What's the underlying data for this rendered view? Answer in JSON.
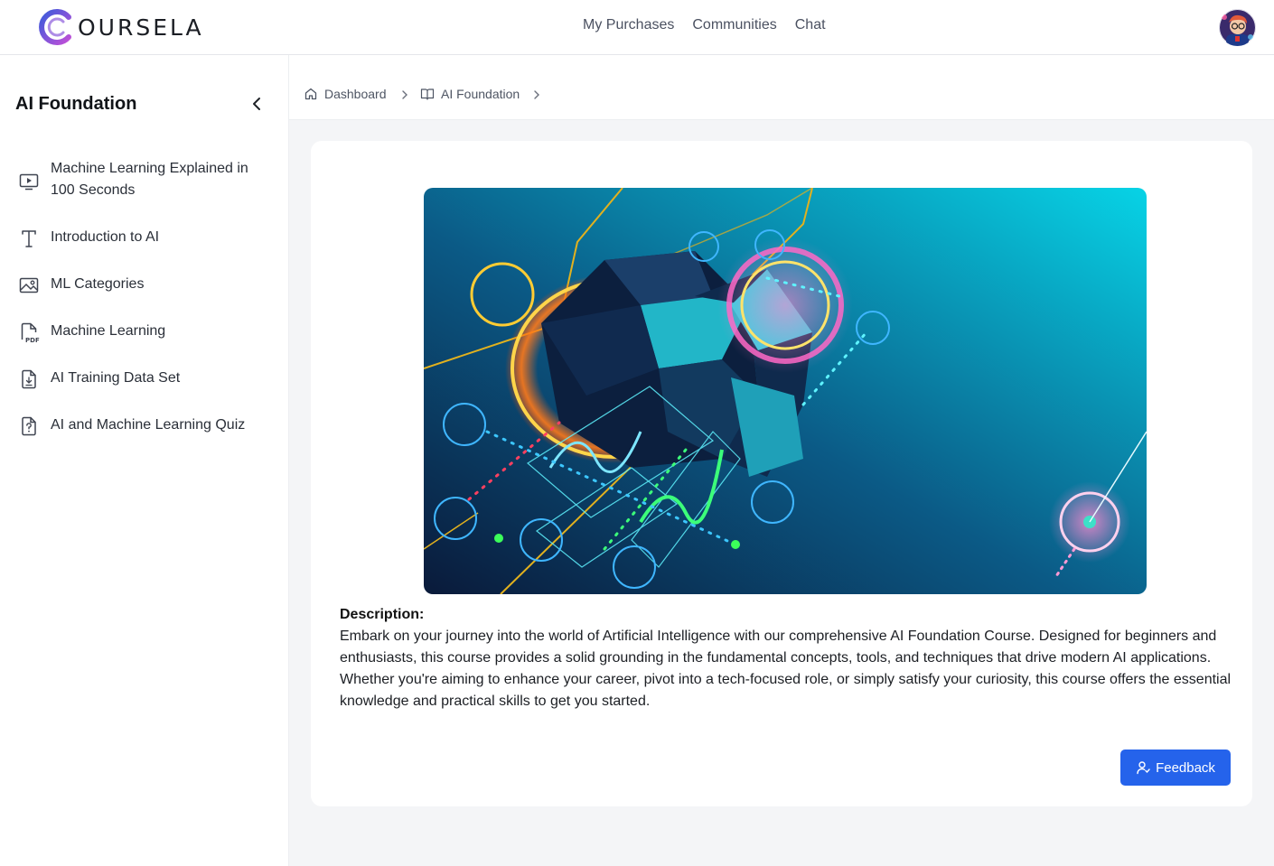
{
  "brand": {
    "name": "OURSELA"
  },
  "nav": {
    "items": [
      "My Purchases",
      "Communities",
      "Chat"
    ]
  },
  "sidebar": {
    "title": "AI Foundation",
    "lessons": [
      {
        "label": "Machine Learning Explained in 100 Seconds",
        "icon": "video-play-icon"
      },
      {
        "label": "Introduction to AI",
        "icon": "text-icon"
      },
      {
        "label": "ML Categories",
        "icon": "image-icon"
      },
      {
        "label": "Machine Learning",
        "icon": "pdf-icon"
      },
      {
        "label": "AI Training Data Set",
        "icon": "file-download-icon"
      },
      {
        "label": "AI and Machine Learning Quiz",
        "icon": "quiz-icon"
      }
    ]
  },
  "breadcrumb": {
    "items": [
      "Dashboard",
      "AI Foundation"
    ]
  },
  "course": {
    "description_heading": "Description:",
    "description": "Embark on your journey into the world of Artificial Intelligence with our comprehensive AI Foundation Course. Designed for beginners and enthusiasts, this course provides a solid grounding in the fundamental concepts, tools, and techniques that drive modern AI applications. Whether you're aiming to enhance your career, pivot into a tech-focused role, or simply satisfy your curiosity, this course offers the essential knowledge and practical skills to get you started."
  },
  "feedback": {
    "label": "Feedback"
  },
  "colors": {
    "accent": "#2563eb",
    "background": "#f4f5f7",
    "logo_gradient": [
      "#3b5bdb",
      "#c04fd8"
    ]
  }
}
